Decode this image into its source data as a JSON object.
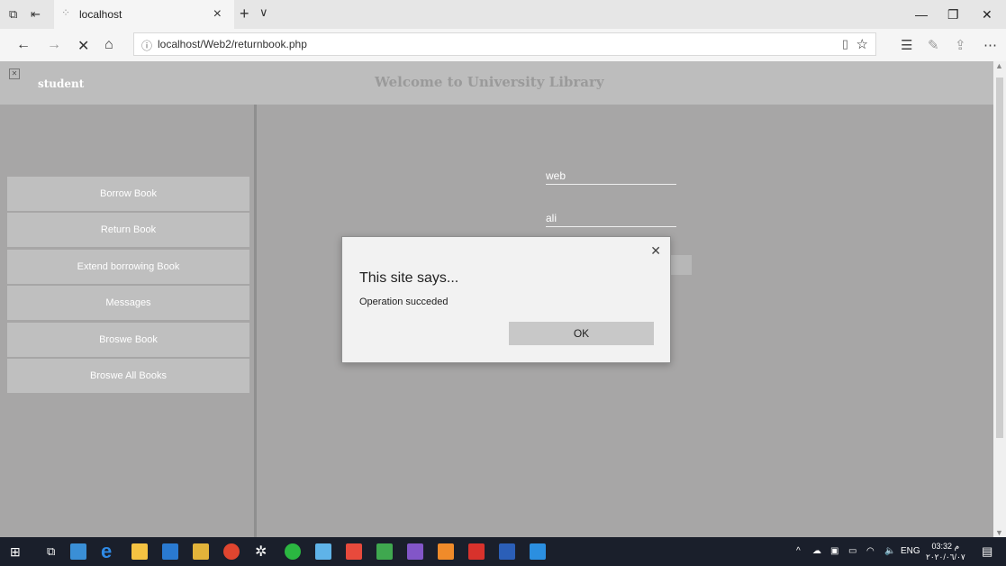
{
  "browser": {
    "tab_title": "localhost",
    "url": "localhost/Web2/returnbook.php"
  },
  "page": {
    "user_label": "student",
    "welcome_title": "Welcome to University Library",
    "menu": [
      {
        "label": "Borrow Book"
      },
      {
        "label": "Return Book"
      },
      {
        "label": "Extend borrowing Book"
      },
      {
        "label": "Messages"
      },
      {
        "label": "Broswe Book"
      },
      {
        "label": "Broswe All Books"
      }
    ],
    "form": {
      "field1_value": "web",
      "field2_value": "ali"
    }
  },
  "dialog": {
    "title": "This site says...",
    "message": "Operation succeded",
    "ok_label": "OK"
  },
  "taskbar": {
    "lang": "ENG",
    "time": "03:32 م",
    "date": "٢٠٢٠/٠٦/٠٧"
  },
  "colors": {
    "page_bg": "#a7a6a6",
    "menu_bg": "#bfbfbf",
    "header_bg": "#bdbdbd"
  }
}
